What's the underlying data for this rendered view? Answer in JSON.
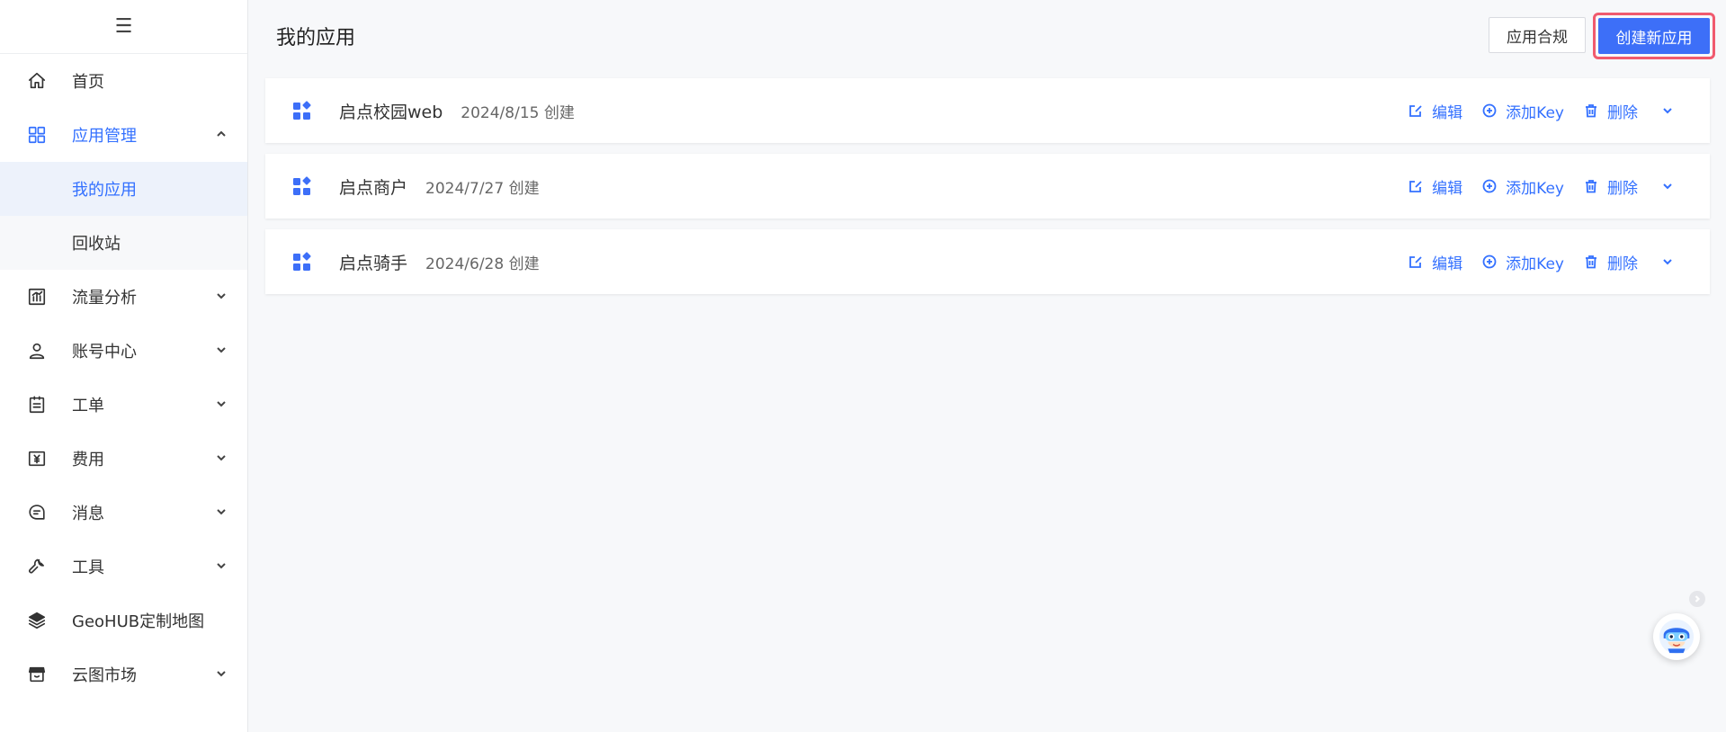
{
  "colors": {
    "accent": "#3370ff",
    "primary_button": "#3d6ff8",
    "highlight_border": "#f05a6e",
    "sidebar_selected_bg": "#edf2fb"
  },
  "sidebar": {
    "toggle_icon": "menu-icon",
    "items": [
      {
        "label": "首页",
        "icon": "home-icon"
      },
      {
        "label": "应用管理",
        "icon": "grid-icon",
        "expanded": true,
        "children": [
          {
            "label": "我的应用",
            "selected": true
          },
          {
            "label": "回收站"
          }
        ]
      },
      {
        "label": "流量分析",
        "icon": "chart-icon"
      },
      {
        "label": "账号中心",
        "icon": "user-icon"
      },
      {
        "label": "工单",
        "icon": "clipboard-icon"
      },
      {
        "label": "费用",
        "icon": "yuan-icon"
      },
      {
        "label": "消息",
        "icon": "message-icon"
      },
      {
        "label": "工具",
        "icon": "wrench-icon"
      },
      {
        "label": "GeoHUB定制地图",
        "icon": "layers-icon"
      },
      {
        "label": "云图市场",
        "icon": "store-icon"
      }
    ]
  },
  "header": {
    "title": "我的应用",
    "compliance_button": "应用合规",
    "create_button": "创建新应用"
  },
  "apps": [
    {
      "name": "启点校园web",
      "created": "2024/8/15 创建"
    },
    {
      "name": "启点商户",
      "created": "2024/7/27 创建"
    },
    {
      "name": "启点骑手",
      "created": "2024/6/28 创建"
    }
  ],
  "actions": {
    "edit": "编辑",
    "add_key": "添加Key",
    "delete": "删除"
  }
}
